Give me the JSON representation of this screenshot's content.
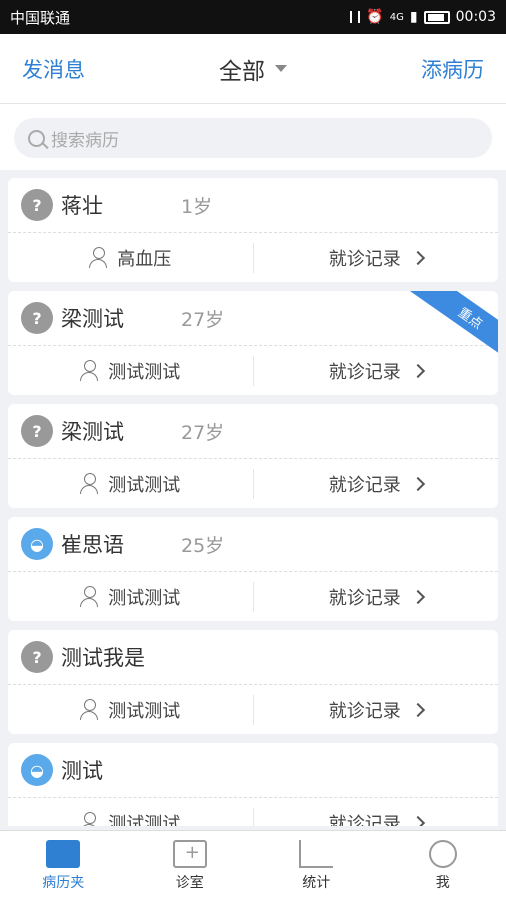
{
  "status": {
    "carrier": "中国联通",
    "time": "00:03",
    "net": "4G"
  },
  "header": {
    "left": "发消息",
    "title": "全部",
    "right": "添病历"
  },
  "search": {
    "placeholder": "搜索病历"
  },
  "patients": [
    {
      "name": "蒋壮",
      "age": "1岁",
      "diagnosis": "高血压",
      "record": "就诊记录",
      "avatar": "grey",
      "badge": ""
    },
    {
      "name": "梁测试",
      "age": "27岁",
      "diagnosis": "测试测试",
      "record": "就诊记录",
      "avatar": "grey",
      "badge": "重点"
    },
    {
      "name": "梁测试",
      "age": "27岁",
      "diagnosis": "测试测试",
      "record": "就诊记录",
      "avatar": "grey",
      "badge": ""
    },
    {
      "name": "崔思语",
      "age": "25岁",
      "diagnosis": "测试测试",
      "record": "就诊记录",
      "avatar": "blue",
      "badge": ""
    },
    {
      "name": "测试我是",
      "age": "",
      "diagnosis": "测试测试",
      "record": "就诊记录",
      "avatar": "grey",
      "badge": ""
    },
    {
      "name": "测试",
      "age": "",
      "diagnosis": "测试测试",
      "record": "就诊记录",
      "avatar": "blue",
      "badge": ""
    }
  ],
  "tabs": [
    {
      "label": "病历夹",
      "icon": "folder-icon"
    },
    {
      "label": "诊室",
      "icon": "medical-kit-icon"
    },
    {
      "label": "统计",
      "icon": "chart-icon"
    },
    {
      "label": "我",
      "icon": "user-icon"
    }
  ],
  "colors": {
    "accent": "#2f7fd3",
    "badge": "#3d8be0"
  }
}
